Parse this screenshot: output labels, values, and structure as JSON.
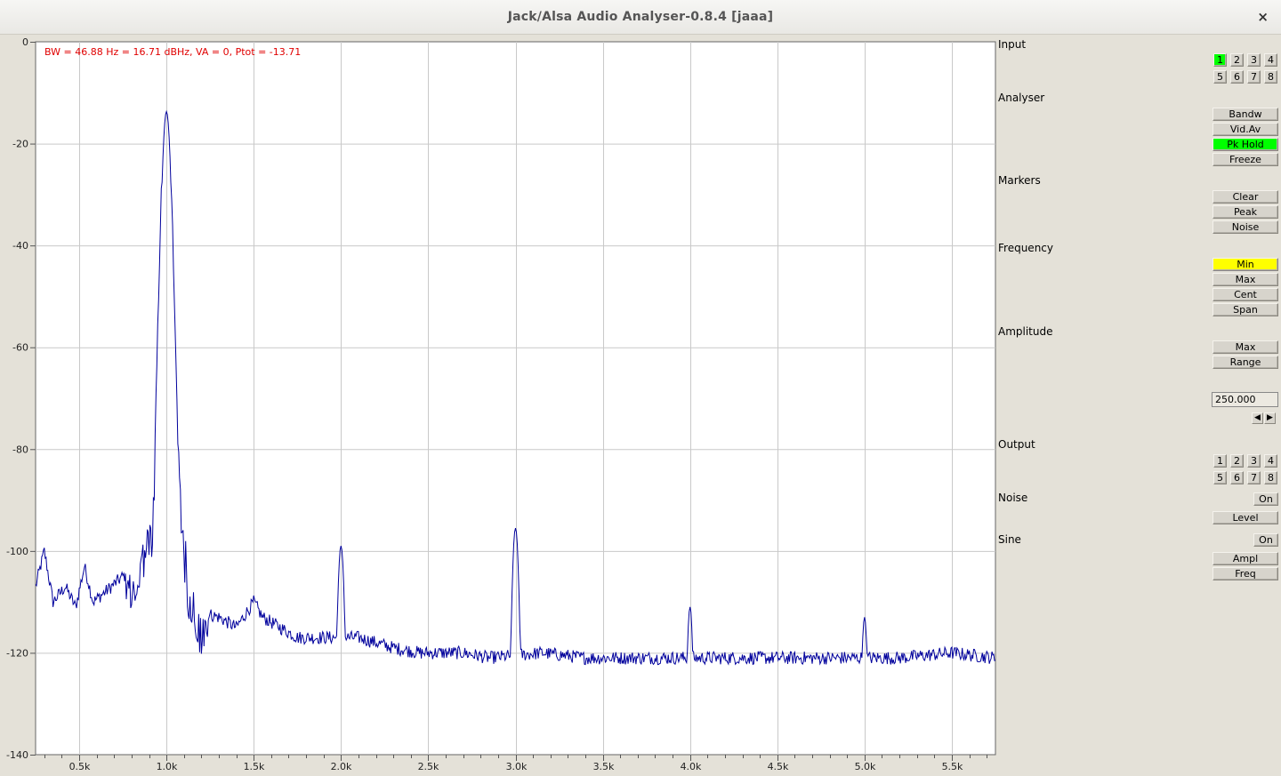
{
  "window": {
    "title": "Jack/Alsa Audio Analyser-0.8.4  [jaaa]",
    "close_glyph": "×"
  },
  "status_line": "BW = 46.88 Hz = 16.71 dBHz, VA = 0, Ptot = -13.71",
  "sections": {
    "input": "Input",
    "analyser": "Analyser",
    "markers": "Markers",
    "frequency": "Frequency",
    "amplitude": "Amplitude",
    "output": "Output",
    "noise": "Noise",
    "sine": "Sine"
  },
  "input_channels": [
    "1",
    "2",
    "3",
    "4",
    "5",
    "6",
    "7",
    "8"
  ],
  "input_selected": "1",
  "analyser_buttons": {
    "bandw": "Bandw",
    "vidav": "Vid.Av",
    "pkhold": "Pk Hold",
    "freeze": "Freeze"
  },
  "marker_buttons": {
    "clear": "Clear",
    "peak": "Peak",
    "noise": "Noise"
  },
  "frequency_buttons": {
    "min": "Min",
    "max": "Max",
    "cent": "Cent",
    "span": "Span"
  },
  "amplitude_buttons": {
    "max": "Max",
    "range": "Range"
  },
  "value_field": "250.000",
  "arrows": {
    "left": "◀",
    "right": "▶"
  },
  "output_channels": [
    "1",
    "2",
    "3",
    "4",
    "5",
    "6",
    "7",
    "8"
  ],
  "noise_controls": {
    "on": "On",
    "level": "Level"
  },
  "sine_controls": {
    "on": "On",
    "ampl": "Ampl",
    "freq": "Freq"
  },
  "colors": {
    "trace": "#00009c",
    "grid": "#c9c9c9",
    "status_text": "#e00000",
    "active_green": "#00ff00",
    "active_yellow": "#ffff00"
  },
  "chart_data": {
    "type": "line",
    "xlim": [
      250,
      5750
    ],
    "ylim": [
      -140,
      0
    ],
    "x_ticks": [
      500,
      1000,
      1500,
      2000,
      2500,
      3000,
      3500,
      4000,
      4500,
      5000,
      5500
    ],
    "x_tick_labels": [
      "0.5k",
      "1.0k",
      "1.5k",
      "2.0k",
      "2.5k",
      "3.0k",
      "3.5k",
      "4.0k",
      "4.5k",
      "5.0k",
      "5.5k"
    ],
    "y_ticks": [
      0,
      -20,
      -40,
      -60,
      -80,
      -100,
      -120,
      -140
    ],
    "y_tick_labels": [
      "0",
      "-20",
      "-40",
      "-60",
      "-80",
      "-100",
      "-120",
      "-140"
    ],
    "grid": true,
    "peaks": [
      {
        "freq": 1000,
        "level": -13.7,
        "width": 55
      },
      {
        "freq": 2000,
        "level": -99,
        "width": 22
      },
      {
        "freq": 3000,
        "level": -95.5,
        "width": 22
      },
      {
        "freq": 4000,
        "level": -111,
        "width": 20
      },
      {
        "freq": 5000,
        "level": -113,
        "width": 20
      }
    ],
    "key_points": [
      [
        250,
        -107
      ],
      [
        300,
        -100
      ],
      [
        350,
        -110
      ],
      [
        420,
        -107
      ],
      [
        480,
        -111
      ],
      [
        530,
        -103
      ],
      [
        580,
        -110
      ],
      [
        650,
        -108
      ],
      [
        750,
        -105
      ],
      [
        820,
        -104
      ],
      [
        880,
        -95
      ],
      [
        920,
        -93
      ],
      [
        940,
        -70
      ],
      [
        970,
        -30
      ],
      [
        1000,
        -14
      ],
      [
        1030,
        -30
      ],
      [
        1060,
        -70
      ],
      [
        1090,
        -93
      ],
      [
        1130,
        -105
      ],
      [
        1200,
        -112
      ],
      [
        1300,
        -113
      ],
      [
        1400,
        -115
      ],
      [
        1500,
        -110
      ],
      [
        1550,
        -113
      ],
      [
        1650,
        -115
      ],
      [
        1750,
        -117
      ],
      [
        1850,
        -117
      ],
      [
        2100,
        -117
      ],
      [
        2200,
        -118
      ],
      [
        2300,
        -119
      ],
      [
        2450,
        -120
      ],
      [
        2700,
        -120
      ],
      [
        2850,
        -121
      ],
      [
        3150,
        -120
      ],
      [
        3400,
        -121
      ],
      [
        3700,
        -121
      ],
      [
        3900,
        -121
      ],
      [
        4200,
        -121
      ],
      [
        4500,
        -121
      ],
      [
        4800,
        -121
      ],
      [
        5200,
        -121
      ],
      [
        5500,
        -120
      ],
      [
        5750,
        -121
      ]
    ]
  }
}
